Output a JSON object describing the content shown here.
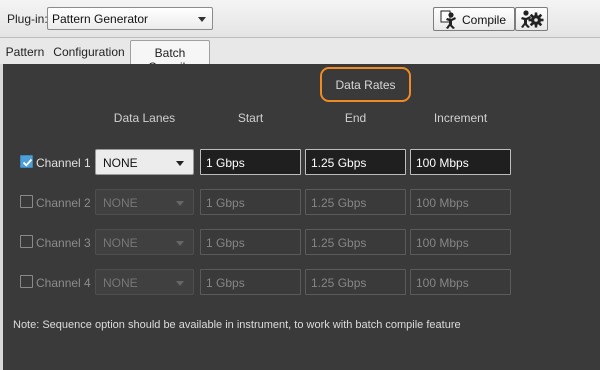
{
  "toolbar": {
    "plugin_label": "Plug-in:",
    "plugin_value": "Pattern Generator",
    "compile_label": "Compile"
  },
  "tabs": [
    {
      "label": "Pattern",
      "active": false
    },
    {
      "label": "Configuration",
      "active": false
    },
    {
      "label": "Batch Compile",
      "active": true
    }
  ],
  "section_title": "Data Rates",
  "columns": {
    "data_lanes": "Data Lanes",
    "start": "Start",
    "end": "End",
    "increment": "Increment"
  },
  "channels": [
    {
      "label": "Channel 1",
      "checked": true,
      "data_lanes": "NONE",
      "start": "1 Gbps",
      "end": "1.25 Gbps",
      "increment": "100 Mbps"
    },
    {
      "label": "Channel 2",
      "checked": false,
      "data_lanes": "NONE",
      "start": "1 Gbps",
      "end": "1.25 Gbps",
      "increment": "100 Mbps"
    },
    {
      "label": "Channel 3",
      "checked": false,
      "data_lanes": "NONE",
      "start": "1 Gbps",
      "end": "1.25 Gbps",
      "increment": "100 Mbps"
    },
    {
      "label": "Channel 4",
      "checked": false,
      "data_lanes": "NONE",
      "start": "1 Gbps",
      "end": "1.25 Gbps",
      "increment": "100 Mbps"
    }
  ],
  "note": "Note: Sequence option should be available in instrument, to work with batch compile feature",
  "icons": {
    "compile": "compile-person-icon",
    "settings": "gear-person-icon",
    "check": "checkmark-icon",
    "dropdown": "chevron-down-icon"
  },
  "colors": {
    "highlight": "#f08a24",
    "checkbox_checked": "#4e9fd6",
    "content_background": "#3a3a3a"
  }
}
